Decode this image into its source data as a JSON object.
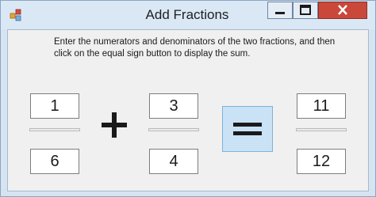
{
  "window": {
    "title": "Add Fractions",
    "controls": {
      "minimize_icon": "minimize-icon",
      "maximize_icon": "maximize-icon",
      "close_icon": "close-icon"
    }
  },
  "instructions": "Enter the numerators and denominators of the two fractions, and then click on the equal sign button to display the sum.",
  "fraction1": {
    "numerator": "1",
    "denominator": "6"
  },
  "operator": "+",
  "fraction2": {
    "numerator": "3",
    "denominator": "4"
  },
  "equal_button": {
    "label": "=",
    "color": "#c9e2f5"
  },
  "result": {
    "numerator": "11",
    "denominator": "12"
  },
  "colors": {
    "close_button": "#c9483a",
    "equal_button": "#c9e2f5",
    "window_frame": "#d6e4f2"
  }
}
